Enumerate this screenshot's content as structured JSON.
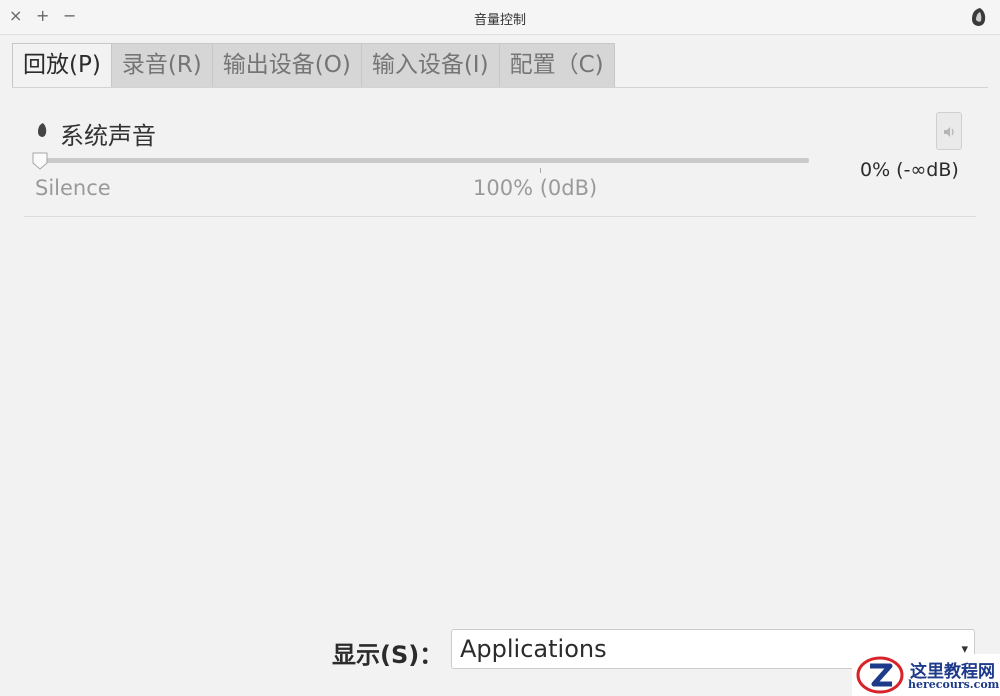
{
  "window": {
    "title": "音量控制",
    "close_glyph": "×",
    "maximize_glyph": "+",
    "minimize_glyph": "−",
    "app_icon": "speaker-icon"
  },
  "tabs": [
    {
      "label": "回放(P)",
      "active": true
    },
    {
      "label": "录音(R)",
      "active": false
    },
    {
      "label": "输出设备(O)",
      "active": false
    },
    {
      "label": "输入设备(I)",
      "active": false
    },
    {
      "label": "配置（C)",
      "active": false
    }
  ],
  "stream": {
    "name": "系统声音",
    "icon": "speaker-small-icon",
    "mute_icon": "volume-icon",
    "volume_percent": 0,
    "volume_value": "0% (-∞dB)",
    "scale_min_label": "Silence",
    "scale_mark_label": "100% (0dB)"
  },
  "footer": {
    "show_label": "显示(S)：",
    "select_value": "Applications",
    "select_arrow": "▾"
  },
  "watermark": {
    "title": "这里教程网",
    "subtitle": "herecours.com"
  },
  "colors": {
    "background": "#f2f2f2",
    "tab_inactive": "#d6d6d6",
    "watermark": "#1e3a8a"
  }
}
